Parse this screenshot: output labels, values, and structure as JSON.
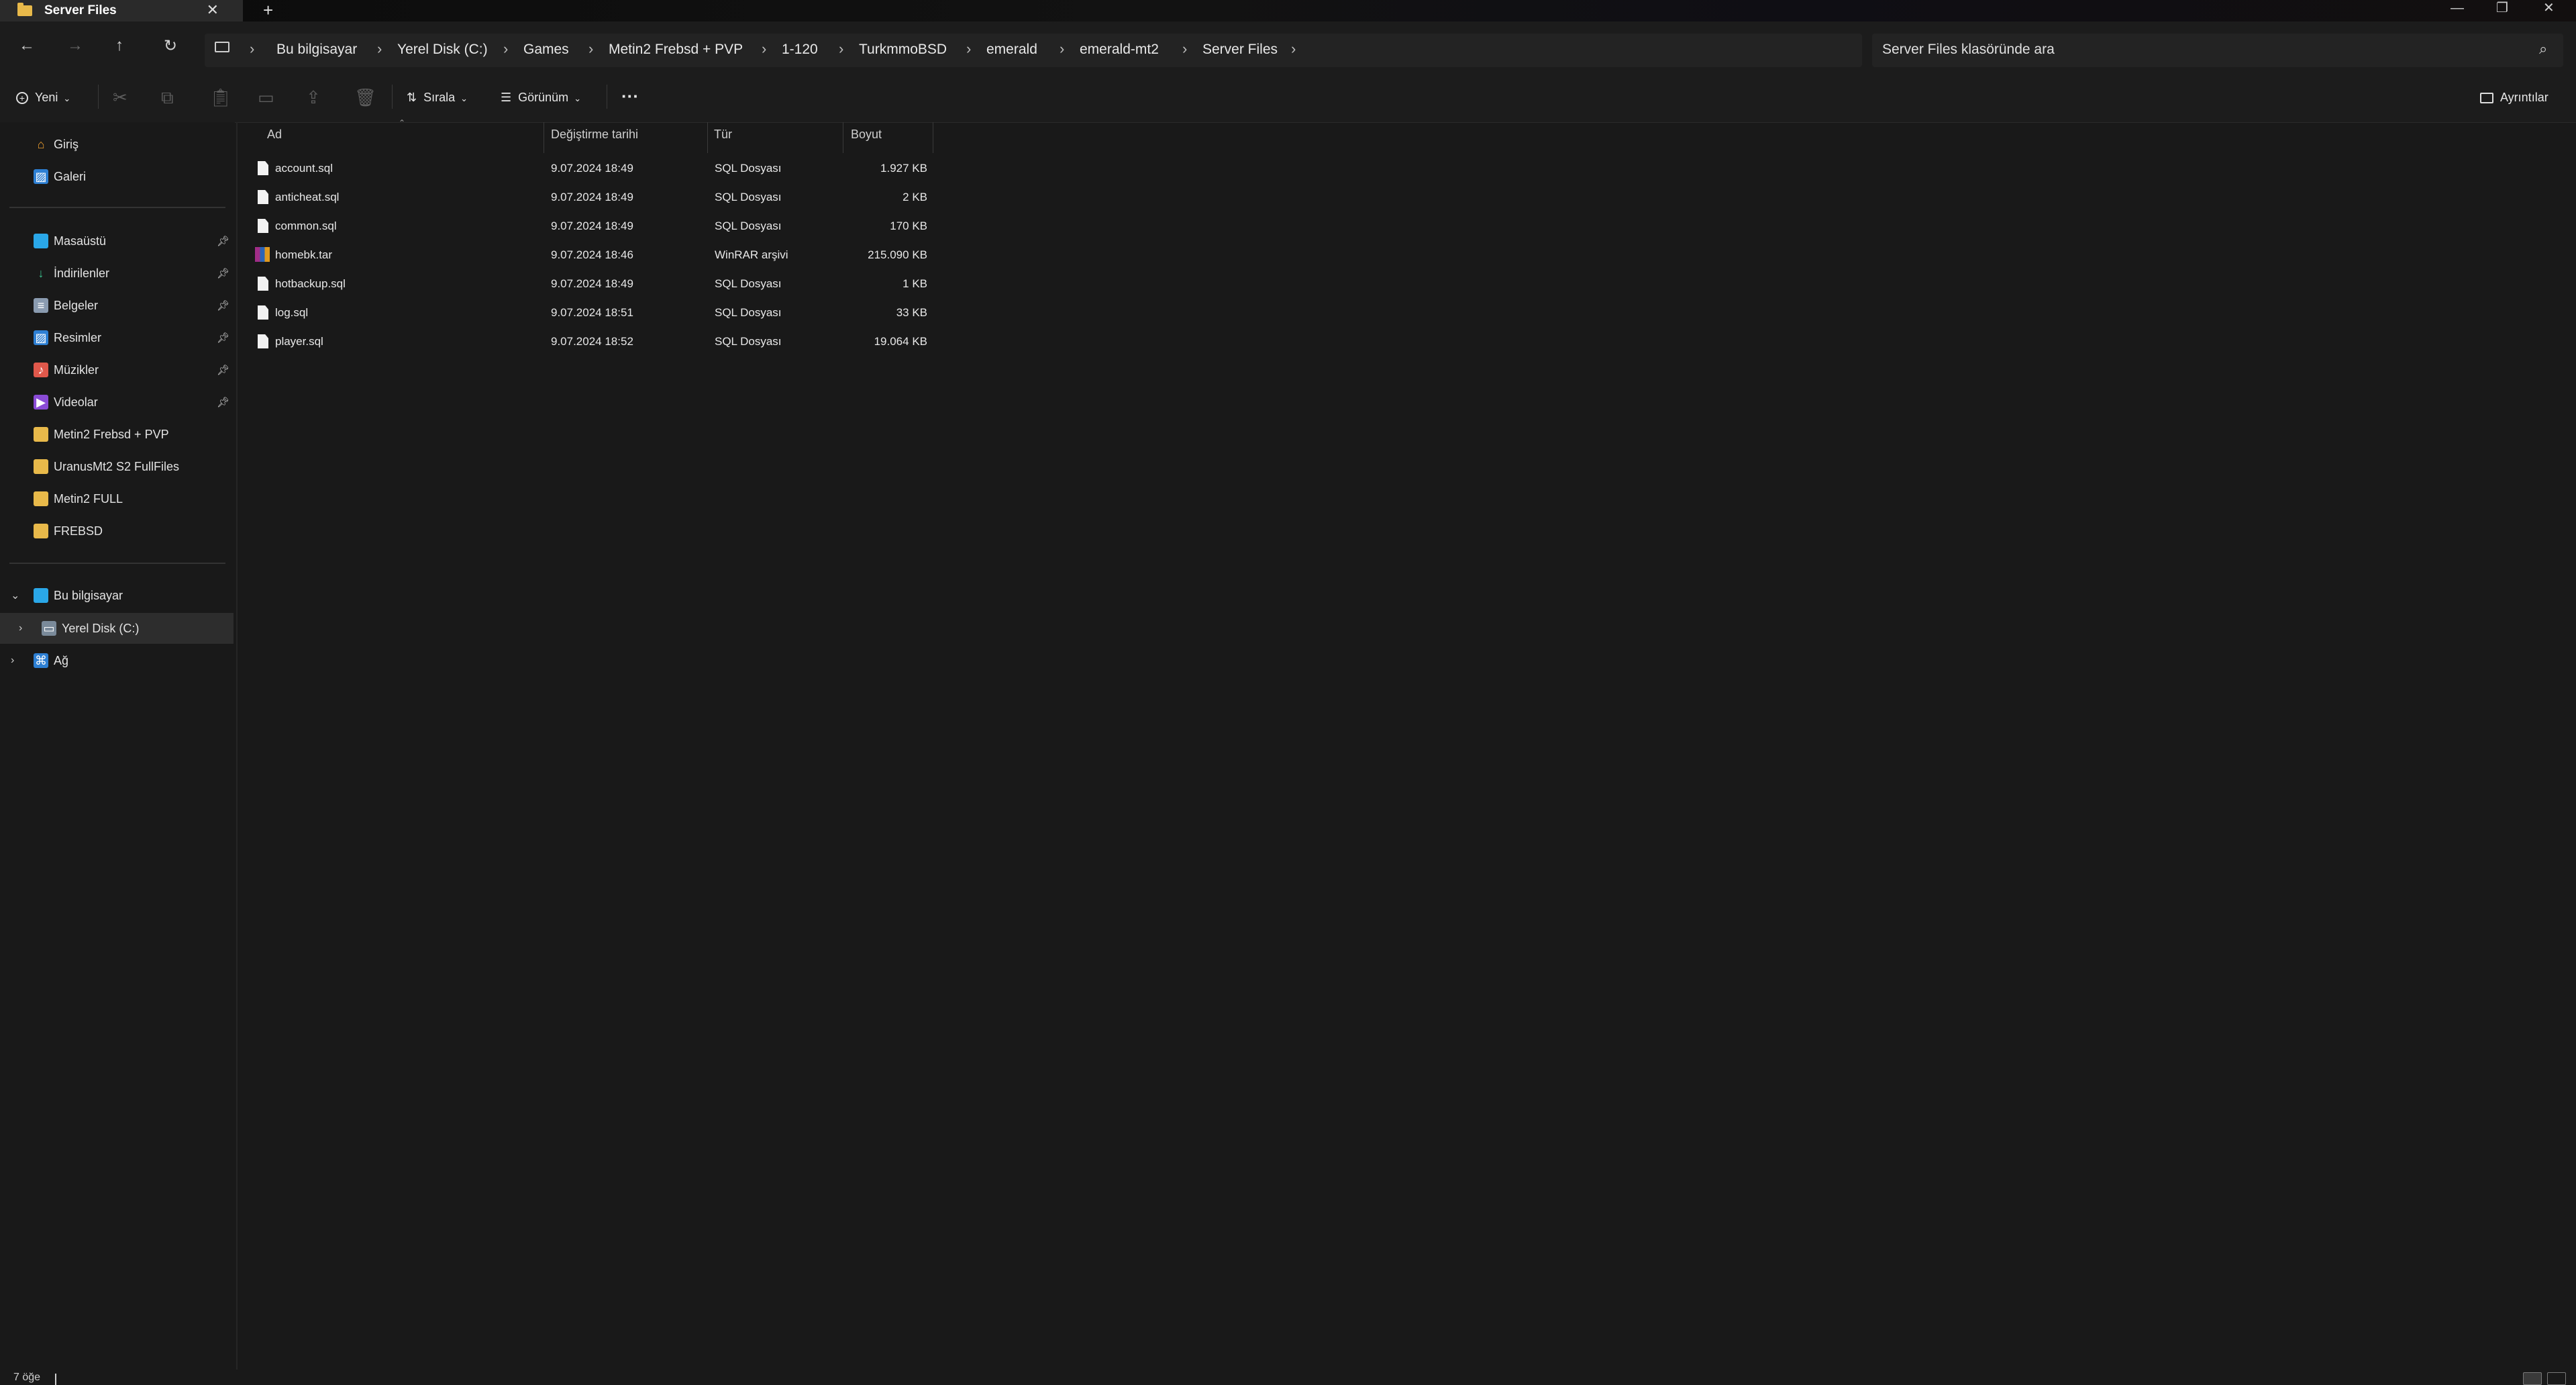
{
  "window": {
    "tab_title": "Server Files",
    "new_tab": "+",
    "tab_close": "✕"
  },
  "nav": {
    "back": "←",
    "forward": "→",
    "up": "↑",
    "refresh": "↻",
    "breadcrumbs": [
      "Bu bilgisayar",
      "Yerel Disk (C:)",
      "Games",
      "Metin2 Frebsd + PVP",
      "1-120",
      "TurkmmoBSD",
      "emerald",
      "emerald-mt2",
      "Server Files"
    ],
    "search_placeholder": "Server Files klasöründe ara"
  },
  "toolbar": {
    "new_label": "Yeni",
    "sort_label": "Sırala",
    "view_label": "Görünüm",
    "more_label": "···",
    "details_label": "Ayrıntılar"
  },
  "sidebar": {
    "quick": [
      {
        "label": "Giriş",
        "icon": "home-icon"
      },
      {
        "label": "Galeri",
        "icon": "gallery-icon"
      }
    ],
    "pinned": [
      {
        "label": "Masaüstü",
        "icon": "desktop-icon",
        "pinned": true
      },
      {
        "label": "İndirilenler",
        "icon": "download-icon",
        "pinned": true
      },
      {
        "label": "Belgeler",
        "icon": "documents-icon",
        "pinned": true
      },
      {
        "label": "Resimler",
        "icon": "pictures-icon",
        "pinned": true
      },
      {
        "label": "Müzikler",
        "icon": "music-icon",
        "pinned": true
      },
      {
        "label": "Videolar",
        "icon": "videos-icon",
        "pinned": true
      },
      {
        "label": "Metin2 Frebsd + PVP",
        "icon": "folder-icon",
        "pinned": false
      },
      {
        "label": "UranusMt2 S2 FullFiles",
        "icon": "folder-icon",
        "pinned": false
      },
      {
        "label": "Metin2 FULL",
        "icon": "folder-icon",
        "pinned": false
      },
      {
        "label": "FREBSD",
        "icon": "folder-icon",
        "pinned": false
      }
    ],
    "tree": [
      {
        "label": "Bu bilgisayar",
        "icon": "computer-icon",
        "expanded": true
      },
      {
        "label": "Yerel Disk (C:)",
        "icon": "drive-icon",
        "expanded": false,
        "selected": true
      },
      {
        "label": "Ağ",
        "icon": "network-icon",
        "expanded": false
      }
    ]
  },
  "columns": {
    "name": "Ad",
    "date": "Değiştirme tarihi",
    "type": "Tür",
    "size": "Boyut"
  },
  "files": [
    {
      "name": "account.sql",
      "date": "9.07.2024 18:49",
      "type": "SQL Dosyası",
      "size": "1.927 KB",
      "icon": "file-icon"
    },
    {
      "name": "anticheat.sql",
      "date": "9.07.2024 18:49",
      "type": "SQL Dosyası",
      "size": "2 KB",
      "icon": "file-icon"
    },
    {
      "name": "common.sql",
      "date": "9.07.2024 18:49",
      "type": "SQL Dosyası",
      "size": "170 KB",
      "icon": "file-icon"
    },
    {
      "name": "homebk.tar",
      "date": "9.07.2024 18:46",
      "type": "WinRAR arşivi",
      "size": "215.090 KB",
      "icon": "winrar-icon"
    },
    {
      "name": "hotbackup.sql",
      "date": "9.07.2024 18:49",
      "type": "SQL Dosyası",
      "size": "1 KB",
      "icon": "file-icon"
    },
    {
      "name": "log.sql",
      "date": "9.07.2024 18:51",
      "type": "SQL Dosyası",
      "size": "33 KB",
      "icon": "file-icon"
    },
    {
      "name": "player.sql",
      "date": "9.07.2024 18:52",
      "type": "SQL Dosyası",
      "size": "19.064 KB",
      "icon": "file-icon"
    }
  ],
  "status": {
    "item_count": "7 öğe"
  }
}
